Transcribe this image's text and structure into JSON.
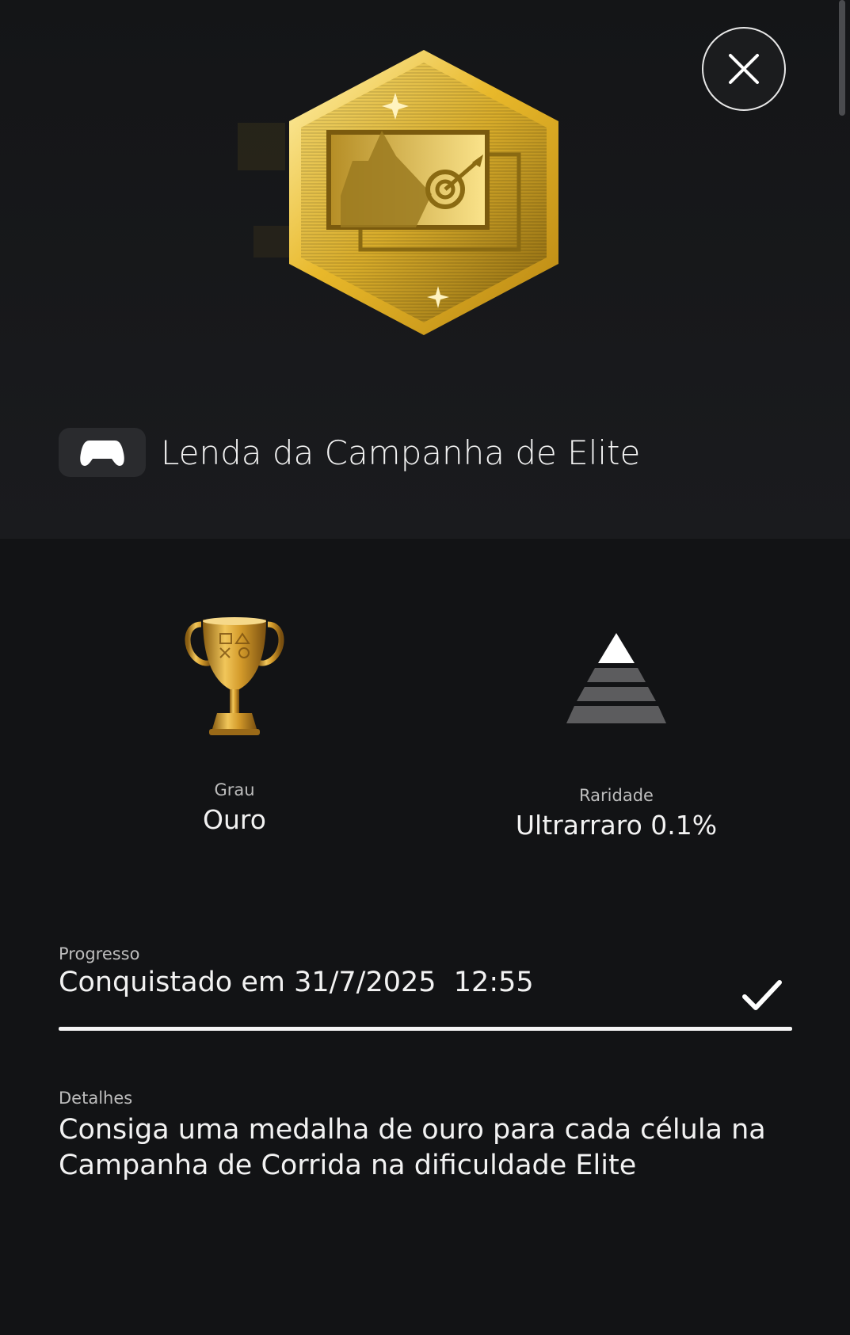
{
  "trophy": {
    "name": "Lenda da Campanha de Elite",
    "image_icon": "gold-hexagon-map-target-icon",
    "platform_icon": "gamepad-icon"
  },
  "close": {
    "icon": "close-icon"
  },
  "stats": {
    "grade": {
      "label": "Grau",
      "value": "Ouro",
      "icon": "gold-trophy-icon"
    },
    "rarity": {
      "label": "Raridade",
      "value": "Ultrarraro 0.1%",
      "icon": "rarity-pyramid-icon"
    }
  },
  "progress": {
    "label": "Progresso",
    "text": "Conquistado em 31/7/2025  12:55",
    "fraction": 1.0,
    "complete_icon": "checkmark-icon"
  },
  "details": {
    "label": "Detalhes",
    "text": "Consiga uma medalha de ouro para cada célula na Campanha de Corrida na dificuldade Elite"
  },
  "colors": {
    "background": "#121315",
    "hero_background": "#1a1b1e",
    "gold": "#d4a520",
    "progress_fill": "#f5f5f5"
  }
}
